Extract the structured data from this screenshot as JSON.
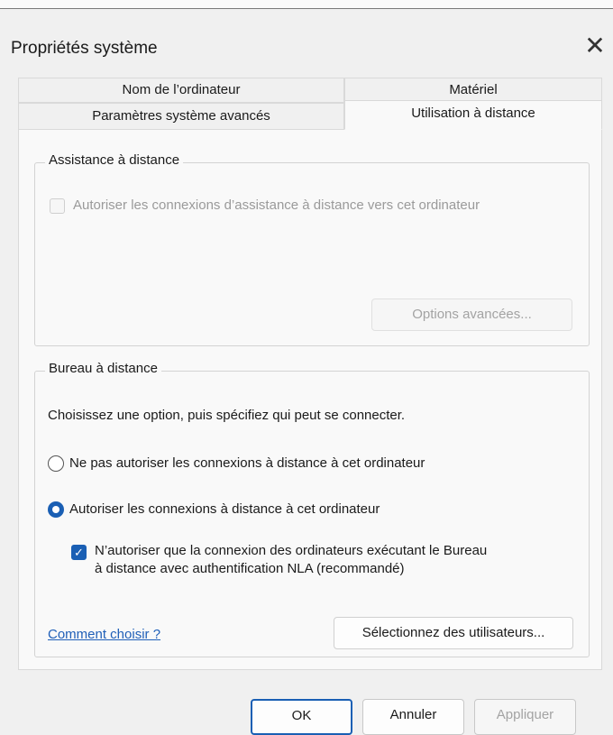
{
  "window": {
    "title": "Propriétés système",
    "close_glyph": "✕"
  },
  "tabs": [
    {
      "label": "Nom de l’ordinateur"
    },
    {
      "label": "Matériel"
    },
    {
      "label": "Paramètres système avancés"
    },
    {
      "label": "Utilisation à distance"
    }
  ],
  "active_tab": "Utilisation à distance",
  "assistance": {
    "legend": "Assistance à distance",
    "checkbox_label": "Autoriser les connexions d’assistance à distance vers cet ordinateur",
    "advanced_button": "Options avancées..."
  },
  "bureau": {
    "legend": "Bureau à distance",
    "instruction": "Choisissez une option, puis spécifiez qui peut se connecter.",
    "radio_deny": "Ne pas autoriser les connexions à distance à cet ordinateur",
    "radio_allow": "Autoriser les connexions à distance à cet ordinateur",
    "nla_line1": "N’autoriser que la connexion des ordinateurs exécutant le Bureau",
    "nla_line2": "à distance avec authentification NLA (recommandé)",
    "help_link": "Comment choisir ?",
    "select_users_button": "Sélectionnez des utilisateurs..."
  },
  "footer": {
    "ok": "OK",
    "cancel": "Annuler",
    "apply": "Appliquer"
  },
  "state": {
    "assistance_checked": false,
    "radio_selected": "allow",
    "nla_checked": true
  },
  "colors": {
    "accent": "#1a5fb4",
    "link": "#1f5fb8"
  },
  "icons": {
    "check": "✓"
  }
}
